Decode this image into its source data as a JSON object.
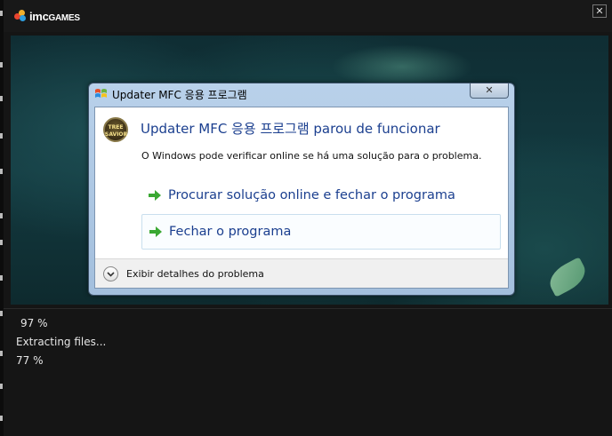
{
  "launcher": {
    "logo_text": "imc",
    "logo_suffix": "GAMES",
    "close_glyph": "✕"
  },
  "dialog": {
    "title": "Updater MFC 응용 프로그램",
    "close_glyph": "✕",
    "heading": "Updater MFC 응용 프로그램 parou de funcionar",
    "app_icon_text": "TREE SAVIOR",
    "message": "O Windows pode verificar online se há uma solução para o problema.",
    "options": [
      {
        "label": "Procurar solução online e fechar o programa"
      },
      {
        "label": "Fechar o programa"
      }
    ],
    "details_label": "Exibir detalhes do problema"
  },
  "log": {
    "lines": [
      "97 %",
      "Extracting files...",
      "77 %"
    ]
  },
  "colors": {
    "heading": "#1b3f8f",
    "arrow_green": "#3aa832"
  },
  "icons": [
    "imcgames-logo-icon",
    "window-close-icon",
    "windows-flag-icon",
    "app-icon",
    "green-arrow-icon",
    "chevron-down-icon"
  ]
}
